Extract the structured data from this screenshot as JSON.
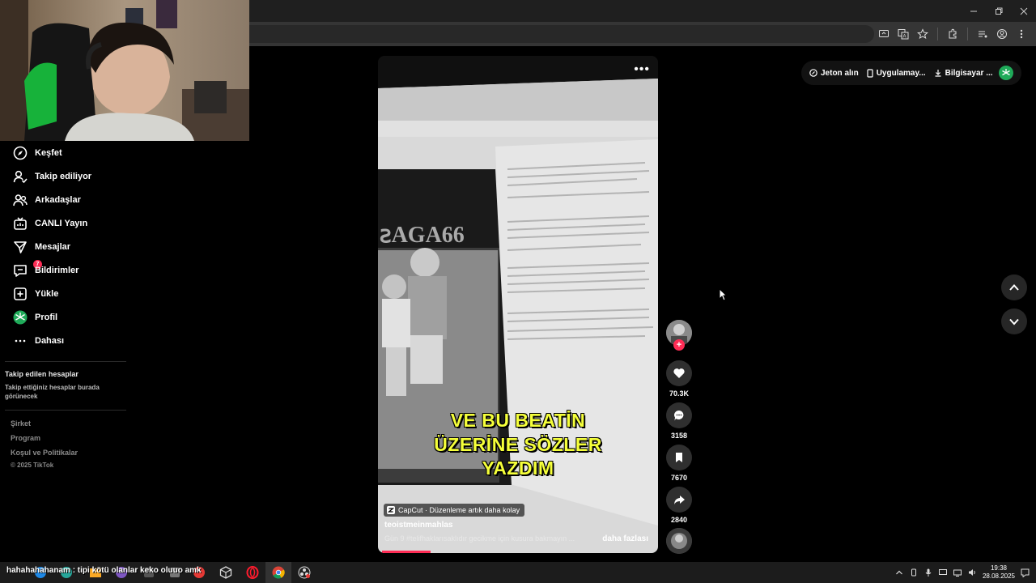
{
  "window": {
    "controls": [
      "minimize",
      "restore",
      "close"
    ]
  },
  "browser_toolbar": {
    "icons": [
      "cast-icon",
      "translate-icon",
      "bookmark-star-icon",
      "extensions-icon",
      "media-icon",
      "profile-icon",
      "menu-icon"
    ]
  },
  "sidebar": {
    "items": [
      {
        "label": "Keşfet",
        "icon": "compass-icon"
      },
      {
        "label": "Takip ediliyor",
        "icon": "following-icon"
      },
      {
        "label": "Arkadaşlar",
        "icon": "friends-icon"
      },
      {
        "label": "CANLI Yayın",
        "icon": "live-icon"
      },
      {
        "label": "Mesajlar",
        "icon": "messages-icon"
      },
      {
        "label": "Bildirimler",
        "icon": "notifications-icon",
        "badge": "7"
      },
      {
        "label": "Yükle",
        "icon": "upload-icon"
      },
      {
        "label": "Profil",
        "icon": "profile-avatar"
      },
      {
        "label": "Dahası",
        "icon": "more-icon"
      }
    ],
    "following_title": "Takip edilen hesaplar",
    "following_desc": "Takip ettiğiniz hesaplar burada görünecek",
    "footer": [
      "Şirket",
      "Program",
      "Koşul ve Politikalar"
    ],
    "copyright": "© 2025 TikTok"
  },
  "header": {
    "coins": "Jeton alın",
    "app": "Uygulamay...",
    "desktop": "Bilgisayar ..."
  },
  "video": {
    "caption_lines": [
      "VE BU BEATİN",
      "ÜZERİNE SÖZLER",
      "YAZDIM"
    ],
    "capcut_tag": "CapCut · Düzenleme artık daha kolay",
    "author": "teoistmeinmahlas",
    "description": "Gün 9  #telifhaklarısaklıdır    gecikme için kusura bakmayın ...",
    "more_label": "daha fazlası",
    "progress_fraction": 0.18
  },
  "actions": {
    "likes": "70.3K",
    "comments": "3158",
    "saves": "7670",
    "shares": "2840"
  },
  "taskbar": {
    "ticker": "hahahahahanam : tipi kötü olanlar keko oluuo amk",
    "time": "19:38",
    "date": "28.08.2025"
  }
}
